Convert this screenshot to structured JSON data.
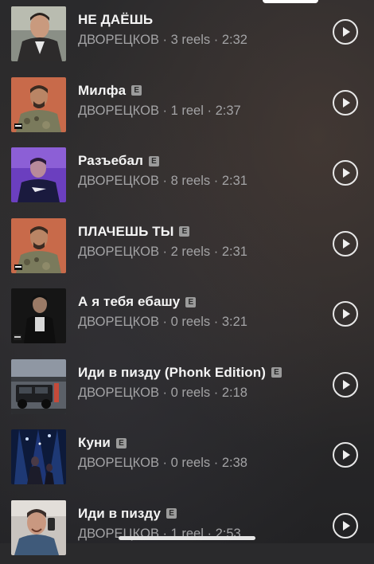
{
  "tracks": [
    {
      "title": "НЕ ДАЁШЬ",
      "explicit": false,
      "artist": "ДВОРЕЦКОВ",
      "reels": "3 reels",
      "duration": "2:32",
      "cover": "cover-man-jacket"
    },
    {
      "title": "Милфа",
      "explicit": true,
      "artist": "ДВОРЕЦКОВ",
      "reels": "1 reel",
      "duration": "2:37",
      "cover": "cover-camo-man"
    },
    {
      "title": "Разъебал",
      "explicit": true,
      "artist": "ДВОРЕЦКОВ",
      "reels": "8 reels",
      "duration": "2:31",
      "cover": "cover-purple-man"
    },
    {
      "title": "ПЛАЧЕШЬ ТЫ",
      "explicit": true,
      "artist": "ДВОРЕЦКОВ",
      "reels": "2 reels",
      "duration": "2:31",
      "cover": "cover-camo-man"
    },
    {
      "title": "А я тебя ебашу",
      "explicit": true,
      "artist": "ДВОРЕЦКОВ",
      "reels": "0 reels",
      "duration": "3:21",
      "cover": "cover-dark-man"
    },
    {
      "title": "Иди в пизду (Phonk Edition)",
      "explicit": true,
      "artist": "ДВОРЕЦКОВ",
      "reels": "0 reels",
      "duration": "2:18",
      "cover": "cover-car"
    },
    {
      "title": "Куни",
      "explicit": true,
      "artist": "ДВОРЕЦКОВ",
      "reels": "0 reels",
      "duration": "2:38",
      "cover": "cover-concert"
    },
    {
      "title": "Иди в пизду",
      "explicit": true,
      "artist": "ДВОРЕЦКОВ",
      "reels": "1 reel",
      "duration": "2:53",
      "cover": "cover-man-phone"
    }
  ],
  "explicit_badge": "E",
  "separator": " · ",
  "icons": {
    "play": "play-icon",
    "explicit": "explicit-icon"
  }
}
